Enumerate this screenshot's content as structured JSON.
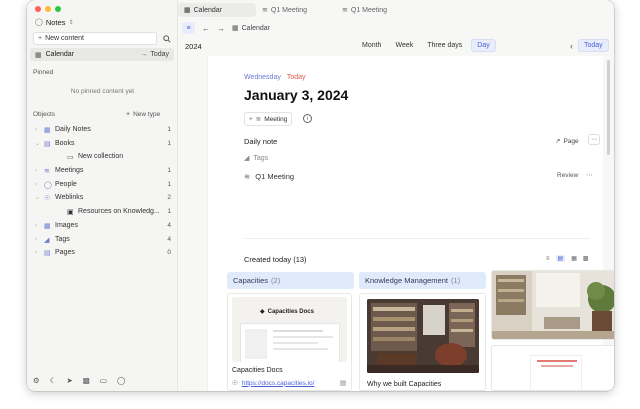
{
  "sidebar": {
    "space_name": "Notes",
    "new_content_label": "New content",
    "calendar_label": "Calendar",
    "today_label": "Today",
    "pinned_header": "Pinned",
    "pinned_empty": "No pinned content yet",
    "objects_header": "Objects",
    "new_type_label": "New type",
    "objects": [
      {
        "label": "Daily Notes",
        "count": "1"
      },
      {
        "label": "Books",
        "count": "1"
      },
      {
        "label": "New collection",
        "count": ""
      },
      {
        "label": "Meetings",
        "count": "1"
      },
      {
        "label": "People",
        "count": "1"
      },
      {
        "label": "Weblinks",
        "count": "2"
      },
      {
        "label": "Resources on Knowledg...",
        "count": "1"
      },
      {
        "label": "Images",
        "count": "4"
      },
      {
        "label": "Tags",
        "count": "4"
      },
      {
        "label": "Pages",
        "count": "0"
      }
    ]
  },
  "tabs": [
    {
      "label": "Calendar"
    },
    {
      "label": "Q1 Meeting"
    },
    {
      "label": "Q1 Meeting"
    }
  ],
  "toolbar": {
    "breadcrumb": "Calendar",
    "year": "2024",
    "views": [
      "Month",
      "Week",
      "Three days",
      "Day"
    ],
    "today_button": "Today"
  },
  "day": {
    "weekday": "Wednesday",
    "today_tag": "Today",
    "date": "January 3, 2024",
    "meeting_chip": "Meeting",
    "daily_note_label": "Daily note",
    "page_label": "Page",
    "tags_label": "Tags",
    "meeting_item": "Q1 Meeting",
    "review_label": "Review"
  },
  "created": {
    "header": "Created today (13)",
    "columns": [
      {
        "name": "Capacities",
        "count": "(2)"
      },
      {
        "name": "Knowledge Management",
        "count": "(1)"
      }
    ],
    "card1_inner_title": "Capacities Docs",
    "card1_title": "Capacities Docs",
    "card1_link": "https://docs.capacities.io/",
    "card2_title": "Why we built Capacities"
  },
  "colors": {
    "accent": "#4a62d8",
    "today_red": "#e0584d",
    "weekday_blue": "#6b7bd0",
    "column_bg": "#dfeafb"
  }
}
